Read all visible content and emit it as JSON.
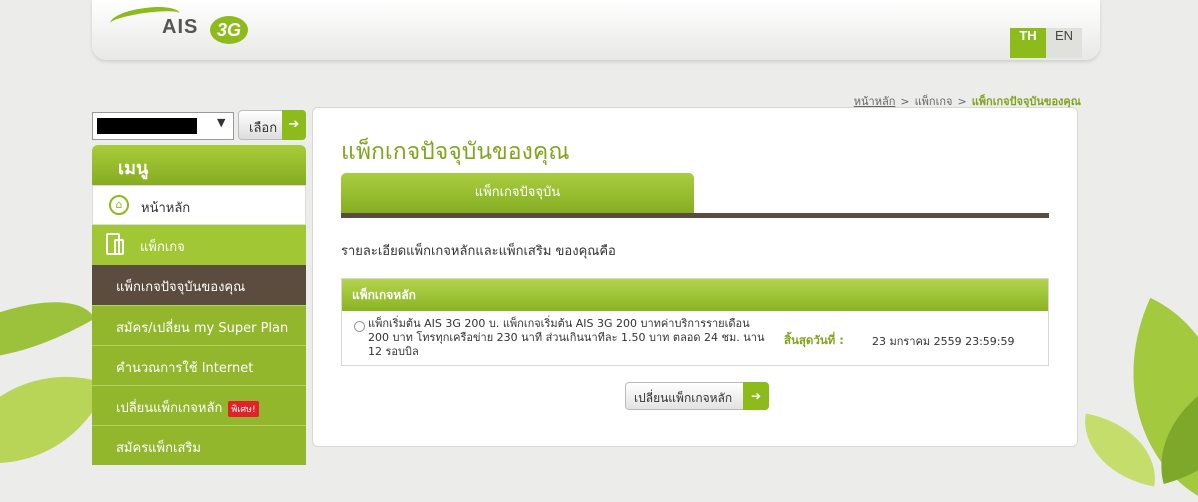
{
  "brand": {
    "name": "AIS",
    "tag": "3G",
    "accent": "#8dbb1c",
    "dark": "#5c4b3f"
  },
  "lang": {
    "th": "TH",
    "en": "EN",
    "selected": "TH"
  },
  "breadcrumb": {
    "home": "หน้าหลัก",
    "sep": ">",
    "middle": "แพ็กเกจ",
    "current": "แพ็กเกจปัจจุบันของคุณ"
  },
  "account_select": {
    "value": ""
  },
  "select_button": "เลือก",
  "menu": {
    "title": "เมนู",
    "home": "หน้าหลัก",
    "package": "แพ็กเกจ",
    "items": [
      "แพ็กเกจปัจจุบันของคุณ",
      "สมัคร/เปลี่ยน my Super Plan",
      "คำนวณการใช้ Internet",
      "เปลี่ยนแพ็กเกจหลัก",
      "สมัครแพ็กเสริม"
    ],
    "new_badge": "พิเศษ!"
  },
  "main": {
    "title": "แพ็กเกจปัจจุบันของคุณ",
    "tab": "แพ็กเกจปัจจุบัน",
    "description": "รายละเอียดแพ็กเกจหลักและแพ็กเสริม ของคุณคือ",
    "package_header": "แพ็กเกจหลัก",
    "package_desc": "แพ็กเริ่มต้น AIS 3G 200 บ. แพ็กเกจเริ่มต้น AIS 3G 200 บาทค่าบริการรายเดือน 200 บาท โทรทุกเครือข่าย 230 นาที ส่วนเกินนาทีละ 1.50 บาท ตลอด 24 ชม. นาน 12 รอบบิล",
    "expiry_label": "สิ้นสุดวันที่ :",
    "expiry_value": "23 มกราคม 2559 23:59:59",
    "change_button": "เปลี่ยนแพ็กเกจหลัก"
  }
}
